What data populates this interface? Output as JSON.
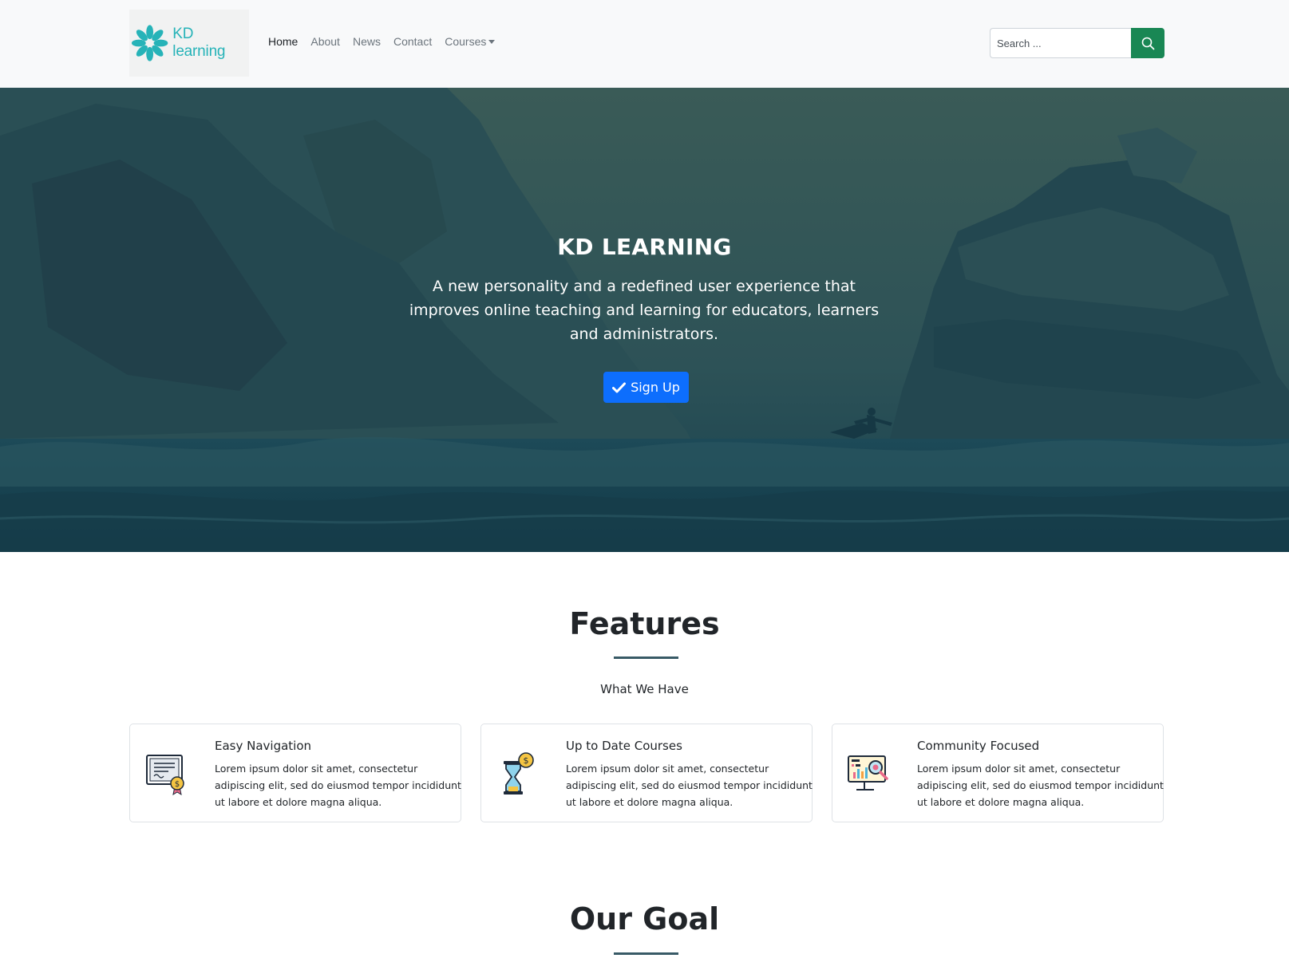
{
  "navbar": {
    "brand_text": "KD learning",
    "links": [
      {
        "label": "Home",
        "active": true
      },
      {
        "label": "About"
      },
      {
        "label": "News"
      },
      {
        "label": "Contact"
      },
      {
        "label": "Courses",
        "dropdown": true
      }
    ],
    "search": {
      "placeholder": "Search ...",
      "button_icon": "search-icon"
    },
    "colors": {
      "brand": "#26b3b8",
      "search_button": "#198754"
    }
  },
  "hero": {
    "title": "KD LEARNING",
    "subtitle": "A new personality and a redefined user experience that improves online teaching and learning for educators, learners and administrators.",
    "signup_label": "Sign Up",
    "signup_icon": "check-icon",
    "colors": {
      "overlay": "#1d4753",
      "button": "#0d6efd"
    }
  },
  "features": {
    "title": "Features",
    "subtitle": "What We Have",
    "cards": [
      {
        "title": "Easy Navigation",
        "text": "Lorem ipsum dolor sit amet, consectetur adipiscing elit, sed do eiusmod tempor incididunt ut labore et dolore magna aliqua.",
        "icon": "certificate-icon"
      },
      {
        "title": "Up to Date Courses",
        "text": "Lorem ipsum dolor sit amet, consectetur adipiscing elit, sed do eiusmod tempor incididunt ut labore et dolore magna aliqua.",
        "icon": "hourglass-coin-icon"
      },
      {
        "title": "Community Focused",
        "text": "Lorem ipsum dolor sit amet, consectetur adipiscing elit, sed do eiusmod tempor incididunt ut labore et dolore magna aliqua.",
        "icon": "monitor-analytics-icon"
      }
    ]
  },
  "goal": {
    "title": "Our Goal"
  }
}
